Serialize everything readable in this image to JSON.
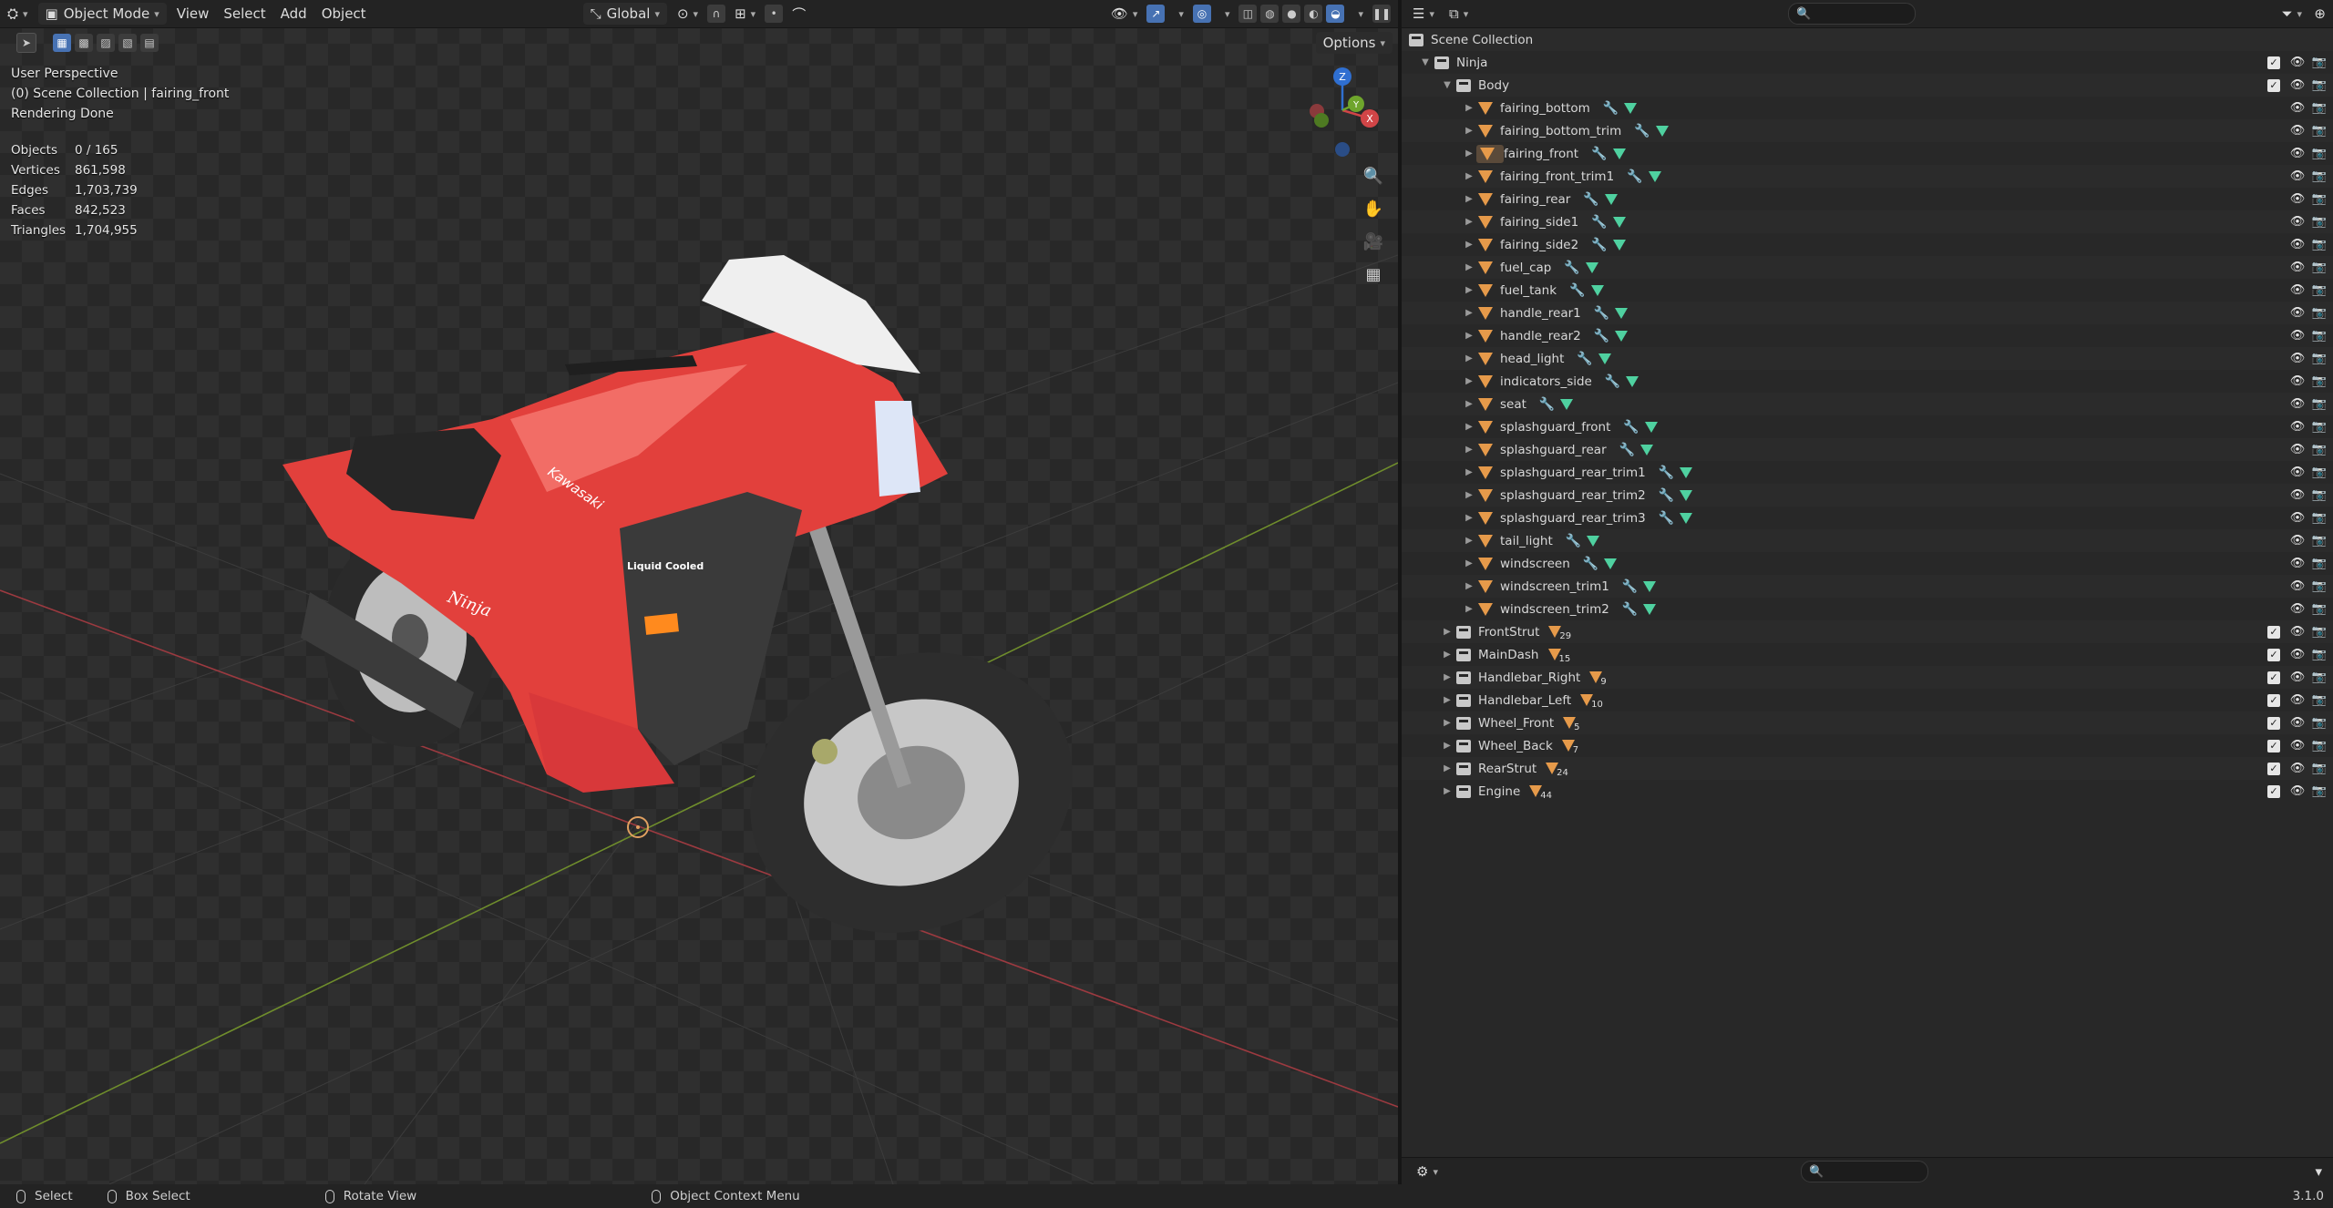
{
  "viewport": {
    "header": {
      "mode": "Object Mode",
      "menus": [
        "View",
        "Select",
        "Add",
        "Object"
      ],
      "orientation": "Global",
      "options": "Options"
    },
    "overlay": {
      "perspective": "User Perspective",
      "collection": "(0) Scene Collection | fairing_front",
      "status": "Rendering Done"
    },
    "stats": [
      {
        "label": "Objects",
        "value": "0 / 165"
      },
      {
        "label": "Vertices",
        "value": "861,598"
      },
      {
        "label": "Edges",
        "value": "1,703,739"
      },
      {
        "label": "Faces",
        "value": "842,523"
      },
      {
        "label": "Triangles",
        "value": "1,704,955"
      }
    ],
    "model_text": {
      "brand": "Kawasaki",
      "side": "Liquid Cooled",
      "model": "Ninja"
    },
    "gizmo": {
      "z": "Z",
      "y": "Y",
      "x": "X"
    }
  },
  "outliner": {
    "root": "Scene Collection",
    "collection": "Ninja",
    "body": "Body",
    "body_items": [
      {
        "name": "fairing_bottom"
      },
      {
        "name": "fairing_bottom_trim"
      },
      {
        "name": "fairing_front"
      },
      {
        "name": "fairing_front_trim1"
      },
      {
        "name": "fairing_rear"
      },
      {
        "name": "fairing_side1"
      },
      {
        "name": "fairing_side2"
      },
      {
        "name": "fuel_cap"
      },
      {
        "name": "fuel_tank"
      },
      {
        "name": "handle_rear1"
      },
      {
        "name": "handle_rear2"
      },
      {
        "name": "head_light"
      },
      {
        "name": "indicators_side"
      },
      {
        "name": "seat"
      },
      {
        "name": "splashguard_front"
      },
      {
        "name": "splashguard_rear"
      },
      {
        "name": "splashguard_rear_trim1"
      },
      {
        "name": "splashguard_rear_trim2"
      },
      {
        "name": "splashguard_rear_trim3"
      },
      {
        "name": "tail_light"
      },
      {
        "name": "windscreen"
      },
      {
        "name": "windscreen_trim1"
      },
      {
        "name": "windscreen_trim2"
      }
    ],
    "groups": [
      {
        "name": "FrontStrut",
        "count": "29"
      },
      {
        "name": "MainDash",
        "count": "15"
      },
      {
        "name": "Handlebar_Right",
        "count": "9"
      },
      {
        "name": "Handlebar_Left",
        "count": "10"
      },
      {
        "name": "Wheel_Front",
        "count": "5"
      },
      {
        "name": "Wheel_Back",
        "count": "7"
      },
      {
        "name": "RearStrut",
        "count": "24"
      },
      {
        "name": "Engine",
        "count": "44"
      }
    ]
  },
  "statusbar": {
    "select": "Select",
    "box_select": "Box Select",
    "rotate": "Rotate View",
    "context": "Object Context Menu",
    "version": "3.1.0"
  }
}
